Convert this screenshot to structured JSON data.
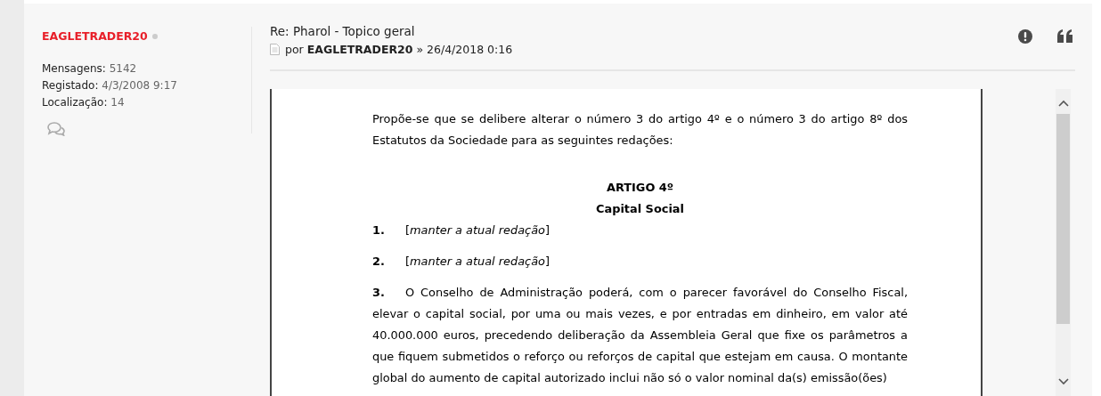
{
  "author": {
    "name": "EAGLETRADER20",
    "online": false,
    "stats": [
      {
        "label": "Mensagens:",
        "value": "5142"
      },
      {
        "label": "Registado:",
        "value": "4/3/2008 9:17"
      },
      {
        "label": "Localização:",
        "value": "14"
      }
    ]
  },
  "post": {
    "title": "Re: Pharol - Topico geral",
    "by": "por",
    "author": "EAGLETRADER20",
    "date": "» 26/4/2018 0:16"
  },
  "document": {
    "intro": "Propõe-se que se delibere alterar o número 3 do artigo 4º e o número 3 do artigo 8º dos Estatutos da Sociedade para as seguintes redações:",
    "heading": "ARTIGO 4º",
    "subheading": "Capital Social",
    "items": [
      {
        "number": "1.",
        "text": "[*manter a atual redação*]"
      },
      {
        "number": "2.",
        "text": "[*manter a atual redação*]"
      },
      {
        "number": "3.",
        "text": "O Conselho de Administração poderá, com o parecer favorável do Conselho Fiscal, elevar o capital social, por uma ou mais vezes, e por entradas em dinheiro, em valor até 40.000.000 euros, precedendo deliberação da Assembleia Geral que fixe os parâmetros a que fiquem submetidos o reforço ou reforços de capital que estejam em causa. O montante global do aumento de capital autorizado inclui não só o valor nominal da(s) emissão(ões)"
      }
    ]
  }
}
